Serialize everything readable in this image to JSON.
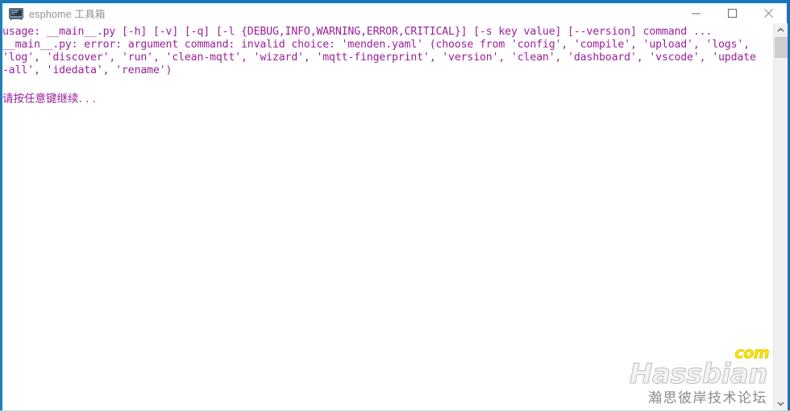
{
  "window": {
    "title": "esphome 工具箱",
    "icon": "console-window-icon",
    "accent_color": "#1479bd",
    "controls": [
      {
        "name": "minimize-button",
        "glyph": "minimize-icon",
        "label": "最小化"
      },
      {
        "name": "maximize-button",
        "glyph": "maximize-icon",
        "label": "最大化"
      },
      {
        "name": "close-button",
        "glyph": "close-icon",
        "label": "关闭"
      }
    ]
  },
  "console": {
    "text_color": "#9b1f9b",
    "background_color": "#ffffff",
    "output": "usage: __main__.py [-h] [-v] [-q] [-l {DEBUG,INFO,WARNING,ERROR,CRITICAL}] [-s key value] [--version] command ...\n__main__.py: error: argument command: invalid choice: 'menden.yaml' (choose from 'config', 'compile', 'upload', 'logs',\n'log', 'discover', 'run', 'clean-mqtt', 'wizard', 'mqtt-fingerprint', 'version', 'clean', 'dashboard', 'vscode', 'update\n-all', 'idedata', 'rename')",
    "prompt": "请按任意键继续. . ."
  },
  "scrollbar": {
    "up_arrow": "chevron-up-icon",
    "down_arrow": "chevron-down-icon",
    "thumb_color": "#cdcdcd",
    "track_color": "#f0f0f0"
  },
  "watermark": {
    "wordmark": "Hassbian",
    "tld": "com",
    "subtitle": "瀚思彼岸技术论坛",
    "tld_color": "#fbe400",
    "wordmark_color": "#f3f3f3"
  }
}
